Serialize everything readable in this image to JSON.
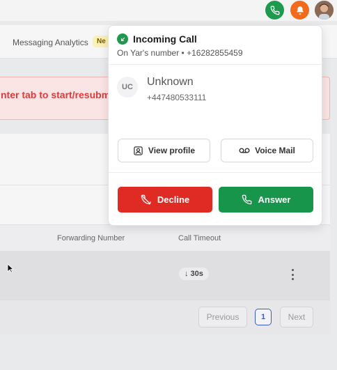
{
  "topbar": {
    "phone_icon": "phone-icon",
    "bell_icon": "bell-icon",
    "avatar": "user-avatar"
  },
  "nav": {
    "messaging_analytics": "Messaging Analytics",
    "badge": "Ne"
  },
  "alert": {
    "text": "nter tab to start/resubm"
  },
  "table": {
    "headers": {
      "forwarding_number": "Forwarding Number",
      "call_timeout": "Call Timeout"
    },
    "row": {
      "timeout": "↓ 30s"
    }
  },
  "pagination": {
    "previous": "Previous",
    "page": "1",
    "next": "Next"
  },
  "incoming_call": {
    "title": "Incoming Call",
    "subtitle": "On Yar's number  •  +16282855459",
    "caller_initials": "UC",
    "caller_name": "Unknown",
    "caller_number": "+447480533111",
    "view_profile": "View profile",
    "voice_mail": "Voice Mail",
    "decline": "Decline",
    "answer": "Answer"
  },
  "colors": {
    "answer_green": "#17954a",
    "decline_red": "#e02b24",
    "alert_red": "#dc3b3b",
    "bell_orange": "#f26a1b",
    "page_accent": "#3b5bc2"
  }
}
